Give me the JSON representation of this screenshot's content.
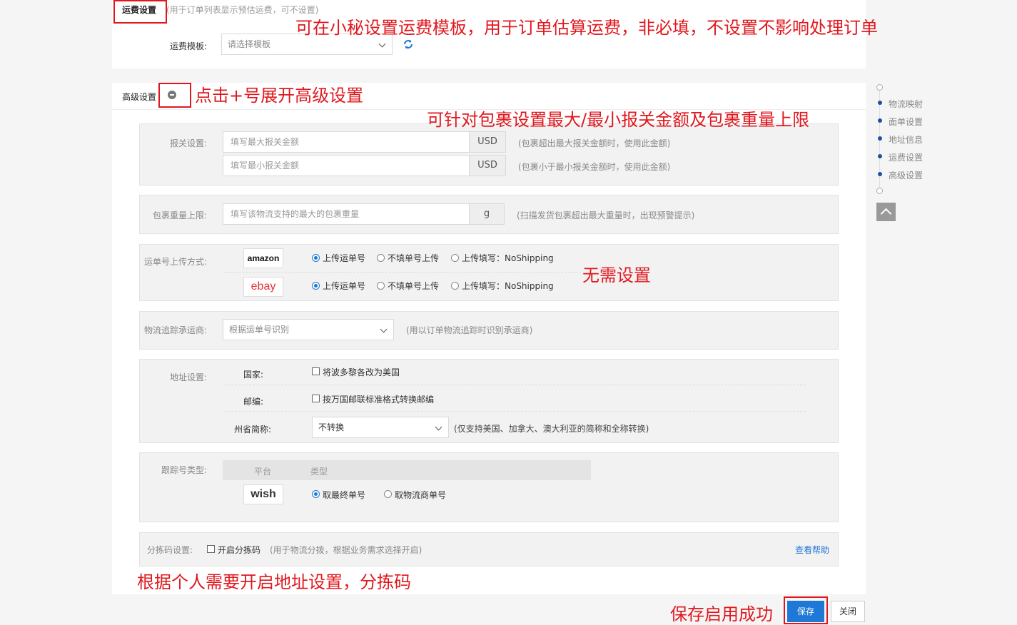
{
  "freight": {
    "title": "运费设置",
    "title_hint": "(用于订单列表显示预估运费，可不设置)",
    "template_label": "运费模板:",
    "template_placeholder": "请选择模板"
  },
  "advanced": {
    "title": "高级设置",
    "customs": {
      "label": "报关设置:",
      "max_placeholder": "填写最大报关金额",
      "min_placeholder": "填写最小报关金额",
      "currency": "USD",
      "max_hint": "(包裹超出最大报关金额时，使用此金额)",
      "min_hint": "(包裹小于最小报关金额时，使用此金额)"
    },
    "weight": {
      "label": "包裹重量上限:",
      "placeholder": "填写该物流支持的最大的包裹重量",
      "unit": "g",
      "hint": "(扫描发货包裹超出最大重量时，出现预警提示)"
    },
    "upload": {
      "label": "运单号上传方式:",
      "platforms": [
        {
          "logo": "amazon",
          "options": [
            "上传运单号",
            "不填单号上传",
            "上传填写：NoShipping"
          ],
          "selected": 0
        },
        {
          "logo": "ebay",
          "options": [
            "上传运单号",
            "不填单号上传",
            "上传填写：NoShipping"
          ],
          "selected": 0
        }
      ]
    },
    "carrier": {
      "label": "物流追踪承运商:",
      "value": "根据运单号识别",
      "hint": "(用以订单物流追踪时识别承运商)"
    },
    "address": {
      "label": "地址设置:",
      "country_label": "国家:",
      "country_option": "将波多黎各改为美国",
      "zip_label": "邮编:",
      "zip_option": "按万国邮联标准格式转换邮编",
      "state_label": "州省简称:",
      "state_value": "不转换",
      "state_hint": "(仅支持美国、加拿大、澳大利亚的简称和全称转换)"
    },
    "tracking_type": {
      "label": "跟踪号类型:",
      "col_platform": "平台",
      "col_type": "类型",
      "platform_logo": "wish",
      "options": [
        "取最终单号",
        "取物流商单号"
      ],
      "selected": 0
    },
    "sort_code": {
      "label": "分拣码设置:",
      "option": "开启分拣码",
      "hint": "(用于物流分拨，根据业务需求选择开启)",
      "help_link": "查看帮助"
    }
  },
  "side_nav": {
    "items": [
      "物流映射",
      "面单设置",
      "地址信息",
      "运费设置",
      "高级设置"
    ]
  },
  "footer": {
    "save": "保存",
    "close": "关闭"
  },
  "annotations": {
    "freight": "可在小秘设置运费模板，用于订单估算运费，非必填，不设置不影响处理订单",
    "expand": "点击+号展开高级设置",
    "customs": "可针对包裹设置最大/最小报关金额及包裹重量上限",
    "upload": "无需设置",
    "address": "根据个人需要开启地址设置，分拣码",
    "save": "保存启用成功"
  },
  "colors": {
    "annotation_red": "#e0181e",
    "primary_blue": "#1e78d6",
    "link_blue": "#1e78d6"
  }
}
